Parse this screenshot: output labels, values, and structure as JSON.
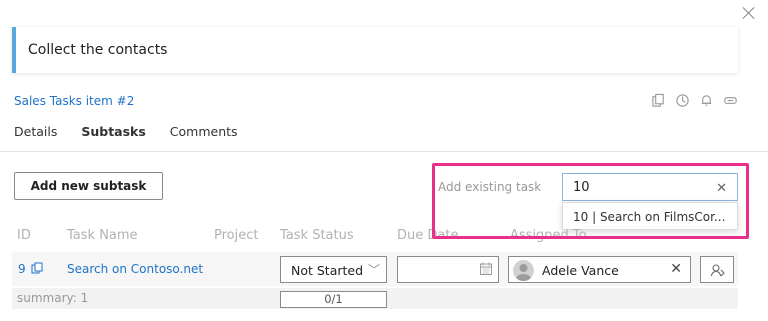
{
  "header": {
    "title": "Collect the contacts",
    "item_link": "Sales Tasks item #2"
  },
  "tabs": [
    {
      "label": "Details",
      "active": false
    },
    {
      "label": "Subtasks",
      "active": true
    },
    {
      "label": "Comments",
      "active": false
    }
  ],
  "toolbar": {
    "icons": [
      "copy-icon",
      "history-icon",
      "bell-icon",
      "minimize-icon"
    ],
    "close_icon": "close-icon"
  },
  "subtasks": {
    "add_button_label": "Add new subtask",
    "add_existing_label": "Add existing task",
    "search_value": "10",
    "suggestion": "10 | Search on FilmsCor...",
    "columns": [
      "ID",
      "Task Name",
      "Project",
      "Task Status",
      "Due Date",
      "Assigned To"
    ],
    "rows": [
      {
        "id": "9",
        "task_name": "Search on Contoso.net",
        "project": "",
        "status": "Not Started",
        "due_date": "",
        "assigned_to": "Adele Vance"
      }
    ],
    "summary_label": "summary: 1",
    "progress": "0/1"
  },
  "colors": {
    "accent": "#5aa7e0",
    "link": "#1e73c9",
    "highlight": "#ea2f8a"
  }
}
